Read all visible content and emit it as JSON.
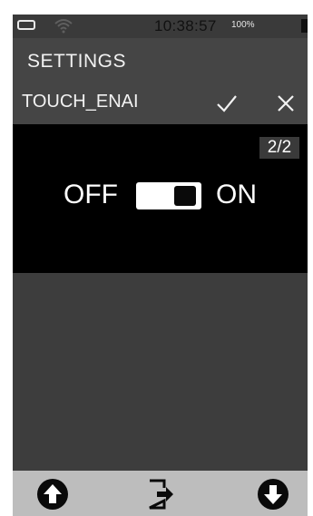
{
  "status_bar": {
    "time": "10:38:57",
    "battery_percent": "100%",
    "icons": [
      "battery-icon",
      "wifi-icon"
    ]
  },
  "header": {
    "title": "SETTINGS"
  },
  "parameter": {
    "name": "TOUCH_ENAI",
    "confirm_icon": "check-icon",
    "cancel_icon": "close-icon"
  },
  "editor": {
    "page_indicator": "2/2",
    "off_label": "OFF",
    "on_label": "ON",
    "toggle_state": "on"
  },
  "bottom_bar": {
    "icons": [
      "arrow-up-circle-icon",
      "exit-icon",
      "arrow-down-circle-icon"
    ]
  },
  "colors": {
    "device_background": "#3d3d3d",
    "panel_background": "#000000",
    "bottom_bar": "#bdbdbd",
    "text": "#f2f2f2"
  }
}
